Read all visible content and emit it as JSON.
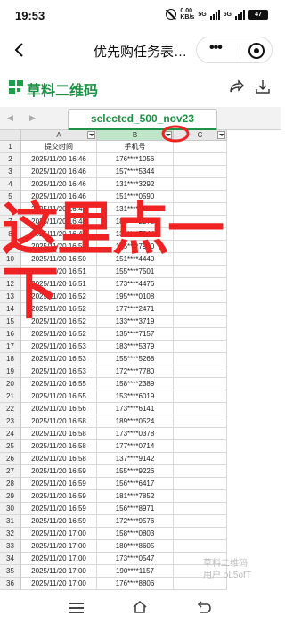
{
  "status_bar": {
    "time": "19:53",
    "net_speed_value": "0.00",
    "net_speed_unit": "KB/s",
    "signal1_label": "5G",
    "signal2_label": "5G",
    "battery": "47"
  },
  "title_bar": {
    "title": "优先购任务表…"
  },
  "app_header": {
    "name": "草料二维码"
  },
  "sheet": {
    "tab_name": "selected_500_nov23",
    "columns": [
      "A",
      "B",
      "C"
    ],
    "rows": [
      {
        "n": "1",
        "a": "提交时间",
        "b": "手机号"
      },
      {
        "n": "2",
        "a": "2025/11/20 16:46",
        "b": "176****1056"
      },
      {
        "n": "3",
        "a": "2025/11/20 16:46",
        "b": "157****5344"
      },
      {
        "n": "4",
        "a": "2025/11/20 16:46",
        "b": "131****3292"
      },
      {
        "n": "5",
        "a": "2025/11/20 16:46",
        "b": "151****0590"
      },
      {
        "n": "6",
        "a": "2025/11/20 16:48",
        "b": "131****9317"
      },
      {
        "n": "7",
        "a": "2025/11/20 16:48",
        "b": "182****2278"
      },
      {
        "n": "8",
        "a": "2025/11/20 16:48",
        "b": "134****7844"
      },
      {
        "n": "9",
        "a": "2025/11/20 16:50",
        "b": "135****7920"
      },
      {
        "n": "10",
        "a": "2025/11/20 16:50",
        "b": "151****4440"
      },
      {
        "n": "11",
        "a": "2025/11/20 16:51",
        "b": "155****7501"
      },
      {
        "n": "12",
        "a": "2025/11/20 16:51",
        "b": "173****4476"
      },
      {
        "n": "13",
        "a": "2025/11/20 16:52",
        "b": "195****0108"
      },
      {
        "n": "14",
        "a": "2025/11/20 16:52",
        "b": "177****2471"
      },
      {
        "n": "15",
        "a": "2025/11/20 16:52",
        "b": "133****3719"
      },
      {
        "n": "16",
        "a": "2025/11/20 16:52",
        "b": "135****7157"
      },
      {
        "n": "17",
        "a": "2025/11/20 16:53",
        "b": "183****5379"
      },
      {
        "n": "18",
        "a": "2025/11/20 16:53",
        "b": "155****5268"
      },
      {
        "n": "19",
        "a": "2025/11/20 16:53",
        "b": "172****7780"
      },
      {
        "n": "20",
        "a": "2025/11/20 16:55",
        "b": "158****2389"
      },
      {
        "n": "21",
        "a": "2025/11/20 16:55",
        "b": "153****6019"
      },
      {
        "n": "22",
        "a": "2025/11/20 16:56",
        "b": "173****6141"
      },
      {
        "n": "23",
        "a": "2025/11/20 16:58",
        "b": "189****0524"
      },
      {
        "n": "24",
        "a": "2025/11/20 16:58",
        "b": "173****0378"
      },
      {
        "n": "25",
        "a": "2025/11/20 16:58",
        "b": "177****0714"
      },
      {
        "n": "26",
        "a": "2025/11/20 16:58",
        "b": "137****9142"
      },
      {
        "n": "27",
        "a": "2025/11/20 16:59",
        "b": "155****9226"
      },
      {
        "n": "28",
        "a": "2025/11/20 16:59",
        "b": "156****6417"
      },
      {
        "n": "29",
        "a": "2025/11/20 16:59",
        "b": "181****7852"
      },
      {
        "n": "30",
        "a": "2025/11/20 16:59",
        "b": "156****8971"
      },
      {
        "n": "31",
        "a": "2025/11/20 16:59",
        "b": "172****9576"
      },
      {
        "n": "32",
        "a": "2025/11/20 17:00",
        "b": "158****0803"
      },
      {
        "n": "33",
        "a": "2025/11/20 17:00",
        "b": "180****8605"
      },
      {
        "n": "34",
        "a": "2025/11/20 17:00",
        "b": "173****0547"
      },
      {
        "n": "35",
        "a": "2025/11/20 17:00",
        "b": "190****1157"
      },
      {
        "n": "36",
        "a": "2025/11/20 17:00",
        "b": "176****8806"
      }
    ]
  },
  "annotation": {
    "line1": "这里点一",
    "line2": "下"
  },
  "watermark": {
    "line1": "草料二维码",
    "line2": "用户 oL5ofT"
  },
  "colors": {
    "brand_green": "#1d9145",
    "annotation_red": "#ef2323",
    "selected_header": "#bfe6c9"
  },
  "icons": [
    "back-icon",
    "more-icon",
    "target-icon",
    "share-icon",
    "download-icon",
    "menu-icon",
    "home-icon",
    "back-nav-icon"
  ]
}
